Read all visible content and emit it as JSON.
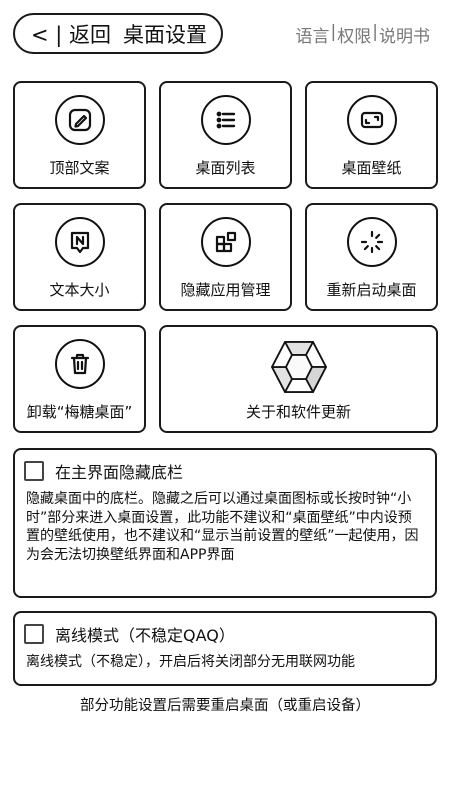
{
  "header": {
    "back_label": "< | 返回",
    "title": "桌面设置",
    "links": [
      "语言",
      "权限",
      "说明书"
    ],
    "separator": "|"
  },
  "tiles": [
    {
      "label": "顶部文案",
      "icon": "edit-icon"
    },
    {
      "label": "桌面列表",
      "icon": "list-icon"
    },
    {
      "label": "桌面壁纸",
      "icon": "wallpaper-icon"
    },
    {
      "label": "文本大小",
      "icon": "text-size-icon"
    },
    {
      "label": "隐藏应用管理",
      "icon": "apps-icon"
    },
    {
      "label": "重新启动桌面",
      "icon": "restart-icon"
    },
    {
      "label": "卸载“梅糖桌面”",
      "icon": "trash-icon"
    },
    {
      "label": "关于和软件更新",
      "icon": "app-logo"
    }
  ],
  "options": [
    {
      "label": "在主界面隐藏底栏",
      "checked": false,
      "description": "隐藏桌面中的底栏。隐藏之后可以通过桌面图标或长按时钟“小时”部分来进入桌面设置，此功能不建议和“桌面壁纸”中内设预置的壁纸使用，也不建议和“显示当前设置的壁纸”一起使用，因为会无法切换壁纸界面和APP界面"
    },
    {
      "label": "离线模式（不稳定QAQ）",
      "checked": false,
      "description": "离线模式（不稳定），开启后将关闭部分无用联网功能"
    }
  ],
  "footer_note": "部分功能设置后需要重启桌面（或重启设备）"
}
